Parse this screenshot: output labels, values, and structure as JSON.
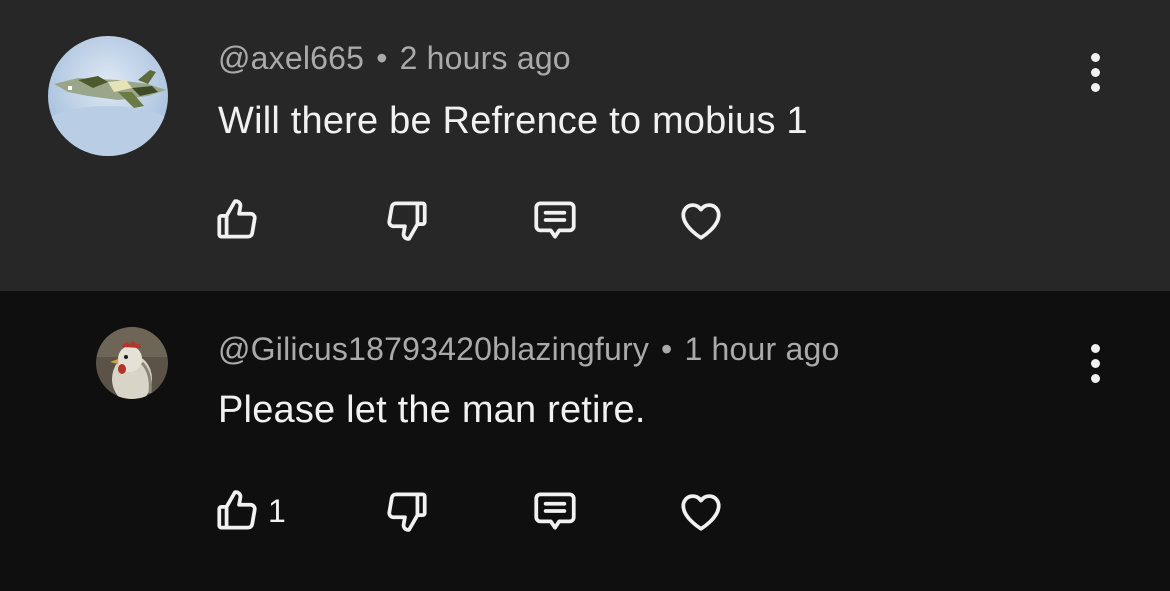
{
  "comments": [
    {
      "author": "@axel665",
      "separator": "•",
      "time": "2 hours ago",
      "text": "Will there be Refrence to mobius 1",
      "like_count": "",
      "avatar_icon": "fighter-jet-avatar"
    },
    {
      "author": "@Gilicus18793420blazingfury",
      "separator": "•",
      "time": "1 hour ago",
      "text": "Please let the man retire.",
      "like_count": "1",
      "avatar_icon": "chicken-avatar"
    }
  ],
  "icons": {
    "like": "thumbs-up-icon",
    "dislike": "thumbs-down-icon",
    "reply": "comment-reply-icon",
    "heart": "heart-icon",
    "more": "more-vertical-icon"
  },
  "colors": {
    "top_background": "#272727",
    "reply_background": "#0f0f0f",
    "primary_text": "#f1f1f1",
    "secondary_text": "#aaaaaa"
  }
}
